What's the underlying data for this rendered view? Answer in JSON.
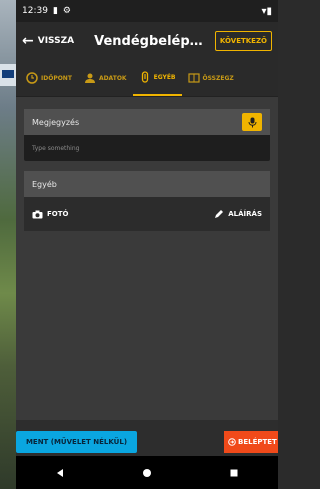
{
  "status_bar": {
    "time": "12:39"
  },
  "toolbar": {
    "back_label": "VISSZA",
    "title": "Vendégbelépés - E...",
    "next_label": "KÖVETKEZŐ"
  },
  "tabs": [
    {
      "label": "IDŐPONT",
      "icon": "clock-icon",
      "active": false
    },
    {
      "label": "ADATOK",
      "icon": "person-icon",
      "active": false
    },
    {
      "label": "EGYÉB",
      "icon": "attachment-icon",
      "active": true
    },
    {
      "label": "ÖSSZEGZ",
      "icon": "summary-icon",
      "active": false
    }
  ],
  "note": {
    "label": "Megjegyzés",
    "placeholder": "Type something"
  },
  "other": {
    "label": "Egyéb",
    "photo_label": "FOTÓ",
    "signature_label": "ALÁÍRÁS"
  },
  "footer": {
    "save_label": "MENT (MŰVELET NÉLKÜL)",
    "checkin_label": "BELÉPTET"
  },
  "colors": {
    "accent": "#f0b400",
    "primary_action": "#0aa6e0",
    "danger_action": "#f04a1a"
  }
}
